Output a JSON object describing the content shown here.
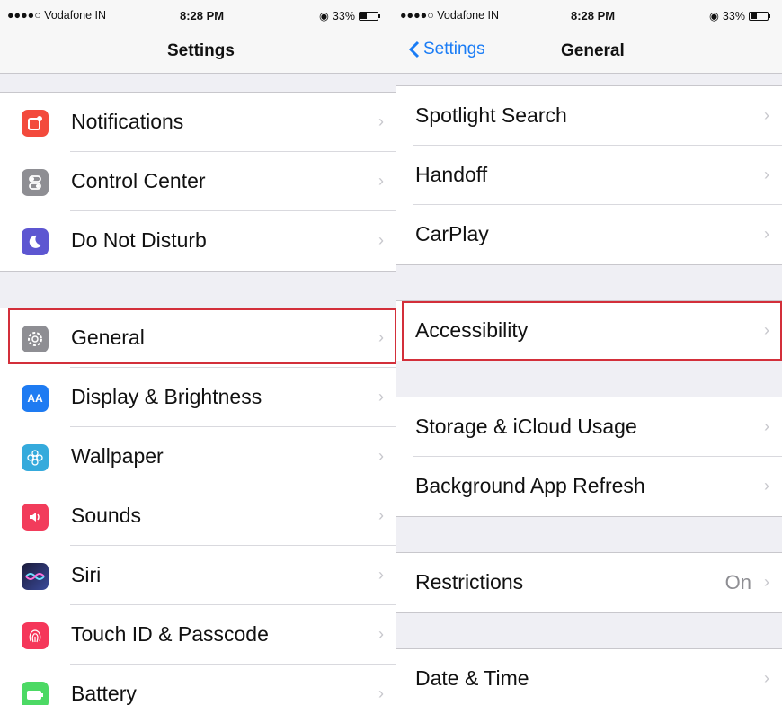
{
  "left": {
    "status": {
      "carrier": "●●●●○ Vodafone IN",
      "time": "8:28 PM",
      "battery": "33%"
    },
    "nav_title": "Settings",
    "groups": [
      [
        {
          "label": "Notifications",
          "icon": "notifications-icon",
          "color": "#f34a3c"
        },
        {
          "label": "Control Center",
          "icon": "control-center-icon",
          "color": "#8e8e93"
        },
        {
          "label": "Do Not Disturb",
          "icon": "moon-icon",
          "color": "#5d56d1"
        }
      ],
      [
        {
          "label": "General",
          "icon": "gear-icon",
          "color": "#8e8e93"
        },
        {
          "label": "Display & Brightness",
          "icon": "display-brightness-icon",
          "color": "#1e7bf2"
        },
        {
          "label": "Wallpaper",
          "icon": "wallpaper-icon",
          "color": "#35aadc"
        },
        {
          "label": "Sounds",
          "icon": "speaker-icon",
          "color": "#f23c5b"
        },
        {
          "label": "Siri",
          "icon": "siri-icon",
          "color": "#2b2a5e"
        },
        {
          "label": "Touch ID & Passcode",
          "icon": "fingerprint-icon",
          "color": "#f5375a"
        },
        {
          "label": "Battery",
          "icon": "battery-icon",
          "color": "#4cd964"
        }
      ]
    ]
  },
  "right": {
    "status": {
      "carrier": "●●●●○ Vodafone IN",
      "time": "8:28 PM",
      "battery": "33%"
    },
    "back_label": "Settings",
    "nav_title": "General",
    "groups": [
      [
        {
          "label": "Spotlight Search"
        },
        {
          "label": "Handoff"
        },
        {
          "label": "CarPlay"
        }
      ],
      [
        {
          "label": "Accessibility"
        }
      ],
      [
        {
          "label": "Storage & iCloud Usage"
        },
        {
          "label": "Background App Refresh"
        }
      ],
      [
        {
          "label": "Restrictions",
          "value": "On"
        }
      ],
      [
        {
          "label": "Date & Time"
        }
      ]
    ]
  },
  "glyphs": {
    "chevron": "›",
    "back_chevron": "‹",
    "wifi": "ᯤ",
    "lock": "◉"
  }
}
